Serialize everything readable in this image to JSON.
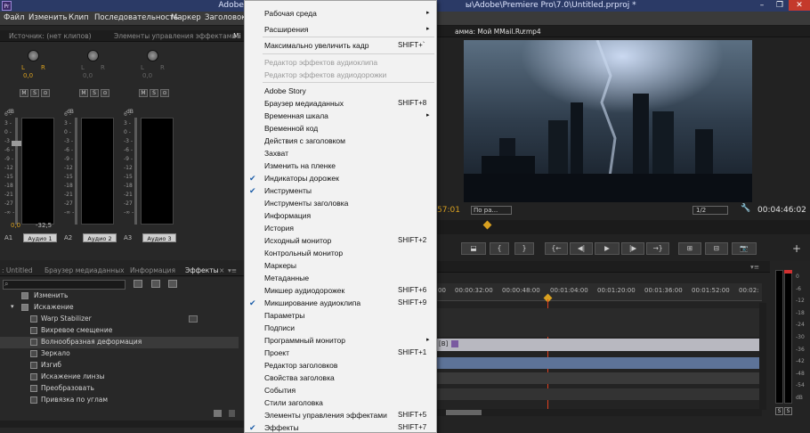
{
  "window": {
    "title": "Adobe Premiere Pro — C:\\Users\\Adobe\\Premiere Pro\\7.0\\Untitled.prproj *",
    "title_left": "Adobe Premie",
    "title_right": "ы\\Adobe\\Premiere Pro\\7.0\\Untitled.prproj *",
    "logo": "Pr",
    "minimize": "–",
    "restore": "❐",
    "close": "✕"
  },
  "menubar": [
    "Файл",
    "Изменить",
    "Клип",
    "Последовательность",
    "Маркер",
    "Заголовок"
  ],
  "top_tabs": {
    "source": "Источник: (нет клипов)",
    "effect_controls": "Элементы управления эффектами",
    "mixer_partial": "Mi",
    "program": "амма: Мой MMail.Ru.mp4",
    "program_menu": "▾"
  },
  "mixer": {
    "channels": [
      {
        "id": "A1",
        "name": "Аудио 1",
        "pan": "0,0",
        "value1": "0,0",
        "value2": "-32,5"
      },
      {
        "id": "A2",
        "name": "Аудио 2",
        "pan": "0,0"
      },
      {
        "id": "A3",
        "name": "Аудио 3",
        "pan": "0,0"
      }
    ],
    "buttons": [
      "M",
      "S",
      "⊙"
    ],
    "db_label": "dB",
    "scale": [
      "6 -",
      "3 -",
      "0 -",
      "-3 -",
      "-6 -",
      "-9 -",
      "-12 -",
      "-15 -",
      "-18 -",
      "-21 -",
      "-27 -",
      "-∞ -"
    ]
  },
  "bottom_tabs": {
    "project": ": Untitled",
    "media_browser": "Браузер медиаданных",
    "info": "Информация",
    "effects": "Эффекты",
    "close": "×",
    "menu": "▾≡"
  },
  "effects": {
    "search_placeholder": "",
    "items": [
      {
        "label": "Изменить",
        "type": "folder",
        "indent": 1
      },
      {
        "label": "Искажение",
        "type": "folder",
        "indent": 1,
        "expanded": true
      },
      {
        "label": "Warp Stabilizer",
        "type": "effect"
      },
      {
        "label": "Вихревое смещение",
        "type": "effect"
      },
      {
        "label": "Волнообразная деформация",
        "type": "effect",
        "selected": true
      },
      {
        "label": "Зеркало",
        "type": "effect"
      },
      {
        "label": "Изгиб",
        "type": "effect"
      },
      {
        "label": "Искажение линзы",
        "type": "effect"
      },
      {
        "label": "Преобразовать",
        "type": "effect"
      },
      {
        "label": "Привязка по углам",
        "type": "effect"
      }
    ]
  },
  "window_menu": {
    "items": [
      {
        "label": "Рабочая среда",
        "arrow": "▸",
        "shortcut": ""
      },
      {
        "label": "Расширения",
        "arrow": "▸",
        "shortcut": ""
      },
      {
        "label": "Максимально увеличить кадр",
        "shortcut": "SHIFT+`"
      },
      {
        "label": "Редактор эффектов аудиоклипа",
        "disabled": true,
        "shortcut": ""
      },
      {
        "label": "Редактор эффектов аудиодорожки",
        "disabled": true,
        "shortcut": ""
      },
      {
        "label": "Adobe Story",
        "shortcut": ""
      },
      {
        "label": "Браузер медиаданных",
        "shortcut": "SHIFT+8"
      },
      {
        "label": "Временная шкала",
        "arrow": "▸",
        "shortcut": ""
      },
      {
        "label": "Временной код",
        "shortcut": ""
      },
      {
        "label": "Действия с заголовком",
        "shortcut": ""
      },
      {
        "label": "Захват",
        "shortcut": ""
      },
      {
        "label": "Изменить на пленке",
        "shortcut": ""
      },
      {
        "label": "Индикаторы дорожек",
        "checked": true,
        "shortcut": ""
      },
      {
        "label": "Инструменты",
        "checked": true,
        "shortcut": ""
      },
      {
        "label": "Инструменты заголовка",
        "shortcut": ""
      },
      {
        "label": "Информация",
        "shortcut": ""
      },
      {
        "label": "История",
        "shortcut": ""
      },
      {
        "label": "Исходный монитор",
        "shortcut": "SHIFT+2"
      },
      {
        "label": "Контрольный монитор",
        "shortcut": ""
      },
      {
        "label": "Маркеры",
        "shortcut": ""
      },
      {
        "label": "Метаданные",
        "shortcut": ""
      },
      {
        "label": "Микшер аудиодорожек",
        "shortcut": "SHIFT+6"
      },
      {
        "label": "Микширование аудиоклипа",
        "checked": true,
        "shortcut": "SHIFT+9"
      },
      {
        "label": "Параметры",
        "shortcut": ""
      },
      {
        "label": "Подписи",
        "shortcut": ""
      },
      {
        "label": "Программный монитор",
        "arrow": "▸",
        "shortcut": ""
      },
      {
        "label": "Проект",
        "shortcut": "SHIFT+1"
      },
      {
        "label": "Редактор заголовков",
        "shortcut": ""
      },
      {
        "label": "Свойства заголовка",
        "shortcut": ""
      },
      {
        "label": "События",
        "shortcut": ""
      },
      {
        "label": "Стили заголовка",
        "shortcut": ""
      },
      {
        "label": "Элементы управления эффектами",
        "shortcut": "SHIFT+5"
      },
      {
        "label": "Эффекты",
        "checked": true,
        "shortcut": "SHIFT+7"
      }
    ],
    "check_glyph": "✔"
  },
  "program_monitor": {
    "timecode_left": "57:01",
    "zoom": "По ра...",
    "resolution": "1/2",
    "timecode_right": "00:04:46:02",
    "wrench": "🔧",
    "add": "+",
    "transport": [
      "⬓",
      "{",
      "}",
      "{←",
      "◀|",
      "▶",
      "|▶",
      "→}",
      "⊞",
      "⊟",
      "📷"
    ]
  },
  "timeline": {
    "ticks": [
      "00:00:32:00",
      "00:00:48:00",
      "00:01:04:00",
      "00:01:20:00",
      "00:01:36:00",
      "00:01:52:00",
      "00:02:"
    ],
    "first_tick": "00",
    "clip_label": "[B]",
    "menu": "▾≡"
  },
  "audio_meters": {
    "scale": [
      "0",
      "-6",
      "-12",
      "-18",
      "-24",
      "-30",
      "-36",
      "-42",
      "-48",
      "-54",
      "dB"
    ],
    "solo": [
      "S",
      "S"
    ]
  },
  "colors": {
    "accent": "#d8a020",
    "menu_bg": "#f2f2f2",
    "check": "#1a5ca8",
    "playhead": "#e04020"
  }
}
